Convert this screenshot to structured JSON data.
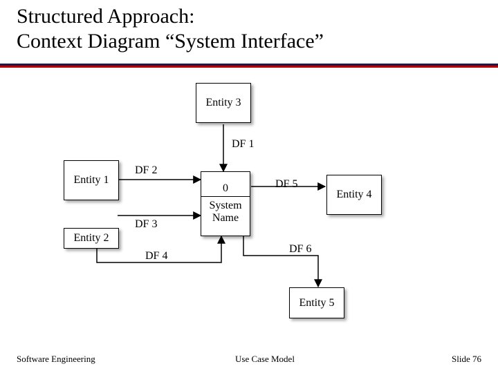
{
  "title_line1": "Structured Approach:",
  "title_line2": "Context Diagram “System Interface”",
  "entities": {
    "e1": "Entity 1",
    "e2": "Entity 2",
    "e3": "Entity 3",
    "e4": "Entity 4",
    "e5": "Entity 5"
  },
  "process": {
    "id": "0",
    "name": "System\nName"
  },
  "flows": {
    "df1": "DF 1",
    "df2": "DF 2",
    "df3": "DF 3",
    "df4": "DF 4",
    "df5": "DF 5",
    "df6": "DF 6"
  },
  "footer": {
    "left": "Software Engineering",
    "mid": "Use Case Model",
    "right": "Slide  76"
  }
}
